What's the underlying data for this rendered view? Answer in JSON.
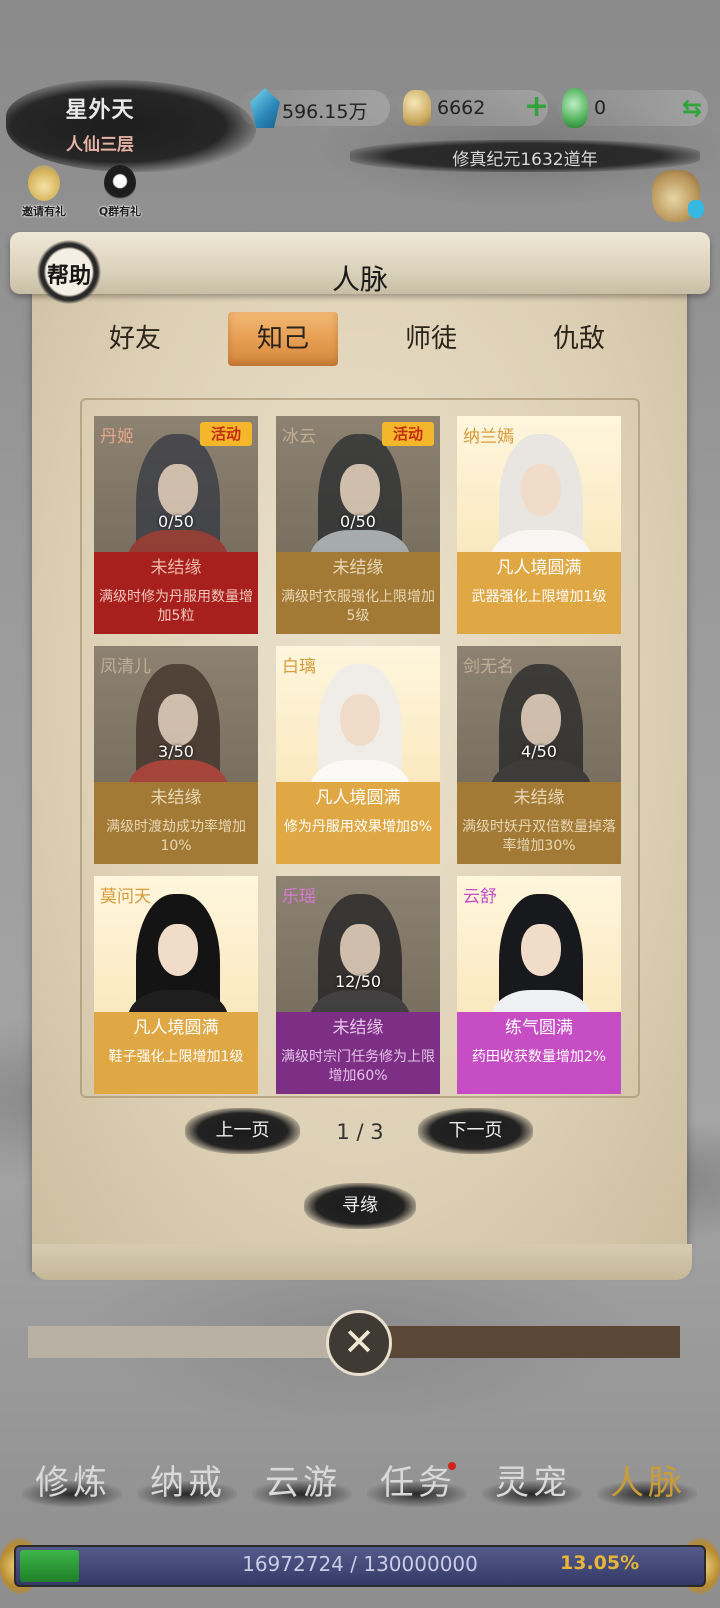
{
  "header": {
    "realm_name": "星外天",
    "realm_level": "人仙三层",
    "spirit_stones": "596.15万",
    "gold_ingots": "6662",
    "jade": "0",
    "era": "修真纪元1632道年",
    "invite_gift": "邀请有礼",
    "qq_gift": "Q群有礼"
  },
  "panel": {
    "help_label": "帮助",
    "title": "人脉",
    "tabs": [
      "好友",
      "知己",
      "师徒",
      "仇敌"
    ],
    "active_tab": 1
  },
  "cards": [
    {
      "name": "丹姬",
      "badge": "活动",
      "progress": "0/50",
      "status": "未结缘",
      "effect": "满级时修为丹服用数量增加5粒",
      "theme": "red"
    },
    {
      "name": "冰云",
      "badge": "活动",
      "progress": "0/50",
      "status": "未结缘",
      "effect": "满级时衣服强化上限增加5级",
      "theme": "ochre"
    },
    {
      "name": "纳兰嫣",
      "badge": "",
      "progress": "",
      "status": "凡人境圆满",
      "effect": "武器强化上限增加1级",
      "theme": "amber"
    },
    {
      "name": "凤清儿",
      "badge": "",
      "progress": "3/50",
      "status": "未结缘",
      "effect": "满级时渡劫成功率增加10%",
      "theme": "ochre"
    },
    {
      "name": "白璃",
      "badge": "",
      "progress": "",
      "status": "凡人境圆满",
      "effect": "修为丹服用效果增加8%",
      "theme": "amber"
    },
    {
      "name": "剑无名",
      "badge": "",
      "progress": "4/50",
      "status": "未结缘",
      "effect": "满级时妖丹双倍数量掉落率增加30%",
      "theme": "ochre"
    },
    {
      "name": "莫问天",
      "badge": "",
      "progress": "",
      "status": "凡人境圆满",
      "effect": "鞋子强化上限增加1级",
      "theme": "amber"
    },
    {
      "name": "乐瑶",
      "badge": "",
      "progress": "12/50",
      "status": "未结缘",
      "effect": "满级时宗门任务修为上限增加60%",
      "theme": "purple"
    },
    {
      "name": "云舒",
      "badge": "",
      "progress": "",
      "status": "练气圆满",
      "effect": "药田收获数量增加2%",
      "theme": "magenta"
    }
  ],
  "pagination": {
    "prev_label": "上一页",
    "next_label": "下一页",
    "indicator": "1 / 3",
    "seek_label": "寻缘"
  },
  "bottom_nav": {
    "items": [
      "修炼",
      "纳戒",
      "云游",
      "任务",
      "灵宠",
      "人脉"
    ],
    "active_index": 5
  },
  "xp": {
    "text": "16972724 / 130000000",
    "percent_text": "13.05%",
    "fill_fraction": 0.1305
  },
  "colors": {
    "accent_gold": "#c99c3a",
    "tab_active": "#e49a4e",
    "card_red": "#a8201d",
    "card_amber": "#e0a844",
    "card_purple": "#7d2f86",
    "card_magenta": "#c64dc4"
  }
}
